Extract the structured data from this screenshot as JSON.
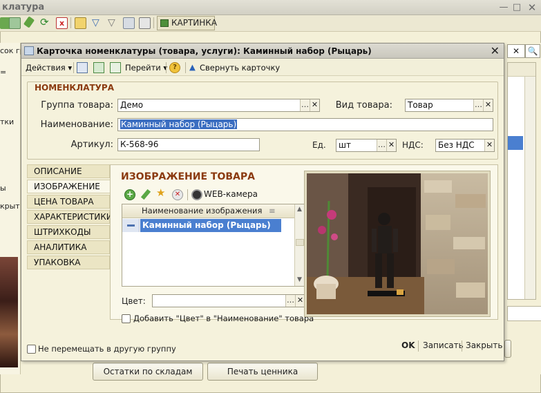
{
  "background_window": {
    "title": "клатура",
    "toolbar_button": "КАРТИНКА",
    "left_fragments": [
      "сок гр",
      "=",
      "тки",
      "ы",
      "крыт"
    ],
    "buttons": {
      "stock": "Остатки по складам",
      "print_label": "Печать ценника"
    }
  },
  "dialog": {
    "title": "Карточка номенклатуры (товара, услуги): Каминный набор (Рыцарь)",
    "toolbar": {
      "actions": "Действия",
      "goto": "Перейти",
      "collapse": "Свернуть карточку"
    },
    "section": "НОМЕНКЛАТУРА",
    "fields": {
      "group_label": "Группа товара:",
      "group_value": "Демо",
      "kind_label": "Вид товара:",
      "kind_value": "Товар",
      "name_label": "Наименование:",
      "name_value": "Каминный набор (Рыцарь)",
      "article_label": "Артикул:",
      "article_value": "К-568-96",
      "unit_label": "Ед.",
      "unit_value": "шт",
      "vat_label": "НДС:",
      "vat_value": "Без НДС"
    },
    "tabs": [
      "ОПИСАНИЕ",
      "ИЗОБРАЖЕНИЕ",
      "ЦЕНА ТОВАРА",
      "ХАРАКТЕРИСТИКИ",
      "ШТРИХКОДЫ",
      "АНАЛИТИКА",
      "УПАКОВКА"
    ],
    "active_tab": "ИЗОБРАЖЕНИЕ",
    "image_section": {
      "title": "ИЗОБРАЖЕНИЕ ТОВАРА",
      "webcam": "WEB-камера",
      "table_header": "Наименование изображения",
      "rows": [
        "Каминный набор (Рыцарь)"
      ],
      "color_label": "Цвет:",
      "color_value": "",
      "add_color_checkbox": "Добавить \"Цвет\" в \"Наименование\" товара"
    },
    "footer": {
      "dont_move": "Не перемещать в другую группу",
      "ok": "OK",
      "save": "Записать",
      "close": "Закрыть"
    }
  },
  "colors": {
    "section_header": "#8b3a10",
    "selection": "#4a7fd0",
    "dialog_bg": "#f5f2dc"
  }
}
